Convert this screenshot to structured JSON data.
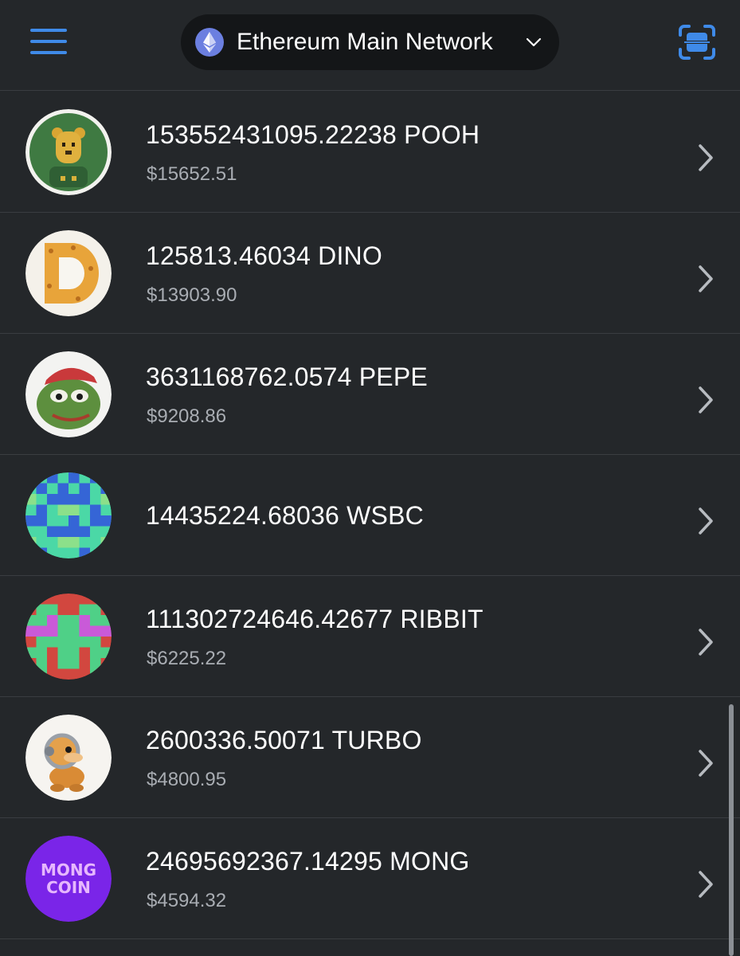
{
  "header": {
    "network": {
      "name": "Ethereum Main Network",
      "icon": "ethereum-icon",
      "dropdown_icon": "chevron-down-icon"
    },
    "menu_icon": "hamburger-menu-icon",
    "scan_icon": "qr-scan-icon",
    "accent_color": "#3f8ae8"
  },
  "tokens": [
    {
      "amount": "153552431095.22238 POOH",
      "fiat": "$15652.51",
      "avatar_icon": "pooh-token-icon"
    },
    {
      "amount": "125813.46034 DINO",
      "fiat": "$13903.90",
      "avatar_icon": "dino-token-icon"
    },
    {
      "amount": "3631168762.0574 PEPE",
      "fiat": "$9208.86",
      "avatar_icon": "pepe-token-icon"
    },
    {
      "amount": "14435224.68036 WSBC",
      "fiat": "",
      "avatar_icon": "wsbc-token-icon"
    },
    {
      "amount": "111302724646.42677 RIBBIT",
      "fiat": "$6225.22",
      "avatar_icon": "ribbit-token-icon"
    },
    {
      "amount": "2600336.50071 TURBO",
      "fiat": "$4800.95",
      "avatar_icon": "turbo-token-icon"
    },
    {
      "amount": "24695692367.14295 MONG",
      "fiat": "$4594.32",
      "avatar_icon": "mong-token-icon",
      "avatar_text": [
        "MONG",
        "COIN"
      ]
    }
  ],
  "colors": {
    "background": "#24272a",
    "pill_background": "#141618",
    "secondary_text": "#a9adb3",
    "divider": "#3a3d41"
  }
}
